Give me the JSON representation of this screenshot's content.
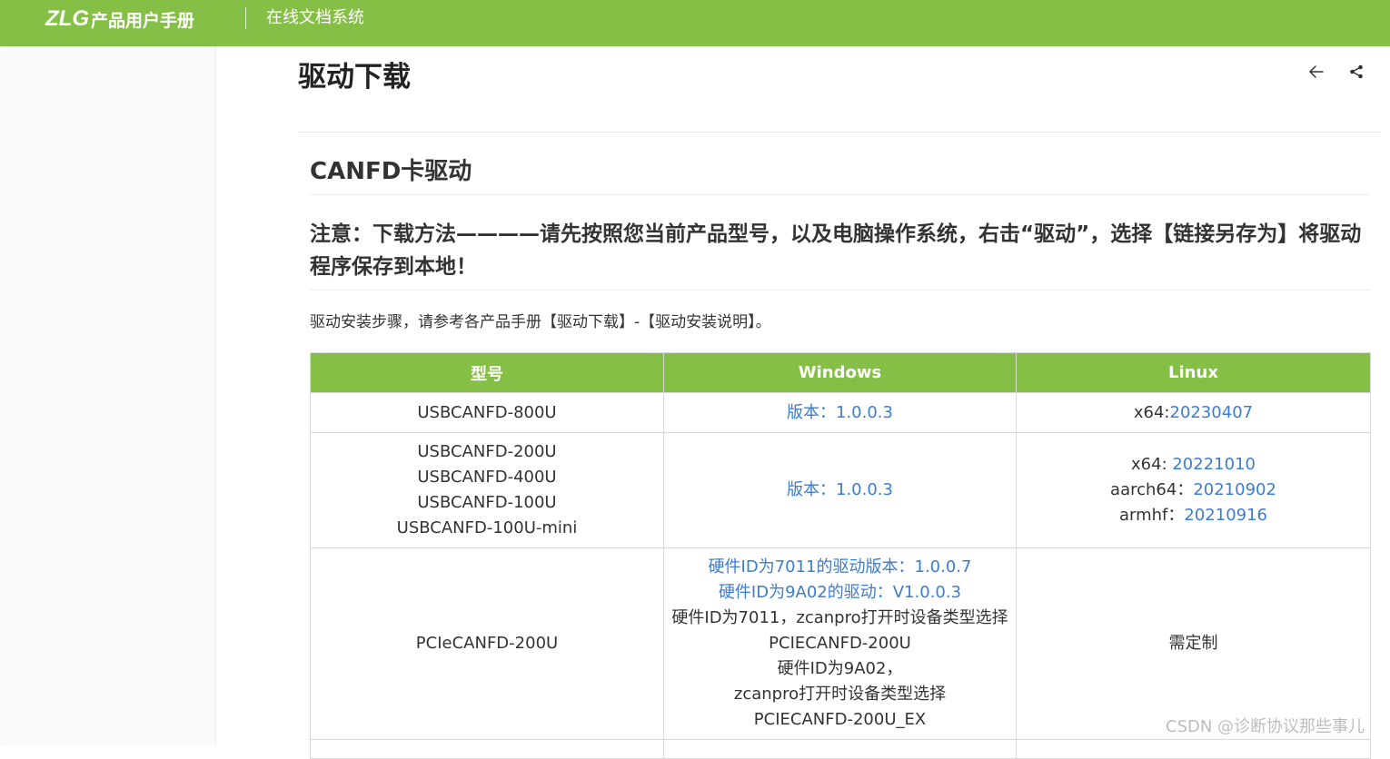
{
  "header": {
    "logo": "ZLG",
    "brand_name": "产品用户手册",
    "site_name": "在线文档系统"
  },
  "page": {
    "title": "驱动下载",
    "icons": [
      "back-arrow-icon",
      "share-icon"
    ]
  },
  "section": {
    "title": "CANFD卡驱动",
    "notice": "注意：下载方法————请先按照您当前产品型号，以及电脑操作系统，右击“驱动”，选择【链接另存为】将驱动程序保存到本地！",
    "install_note": "驱动安装步骤，请参考各产品手册【驱动下载】-【驱动安装说明】。"
  },
  "table": {
    "headers": [
      "型号",
      "Windows",
      "Linux"
    ],
    "rows": [
      {
        "models": [
          "USBCANFD-800U"
        ],
        "windows": [
          {
            "text": "版本：1.0.0.3",
            "link": true
          }
        ],
        "linux": [
          {
            "prefix": "x64:",
            "link_text": "20230407"
          }
        ]
      },
      {
        "models": [
          "USBCANFD-200U",
          "USBCANFD-400U",
          "USBCANFD-100U",
          "USBCANFD-100U-mini"
        ],
        "windows": [
          {
            "text": "版本：1.0.0.3",
            "link": true
          }
        ],
        "linux": [
          {
            "prefix": "x64: ",
            "link_text": "20221010"
          },
          {
            "prefix": "aarch64：",
            "link_text": "20210902"
          },
          {
            "prefix": "armhf：",
            "link_text": "20210916"
          }
        ]
      },
      {
        "models": [
          "PCIeCANFD-200U"
        ],
        "windows": [
          {
            "text": "硬件ID为7011的驱动版本：1.0.0.7",
            "link": true
          },
          {
            "text": "硬件ID为9A02的驱动：V1.0.0.3",
            "link": true
          },
          {
            "text": "硬件ID为7011，zcanpro打开时设备类型选择",
            "link": false
          },
          {
            "text": "PCIECANFD-200U",
            "link": false
          },
          {
            "text": "硬件ID为9A02，",
            "link": false
          },
          {
            "text": "zcanpro打开时设备类型选择",
            "link": false
          },
          {
            "text": "PCIECANFD-200U_EX",
            "link": false
          }
        ],
        "linux_text": "需定制"
      }
    ]
  },
  "watermark": "CSDN @诊断协议那些事儿",
  "colors": {
    "brand_green": "#86bf45",
    "link_blue": "#3d7ccf"
  }
}
